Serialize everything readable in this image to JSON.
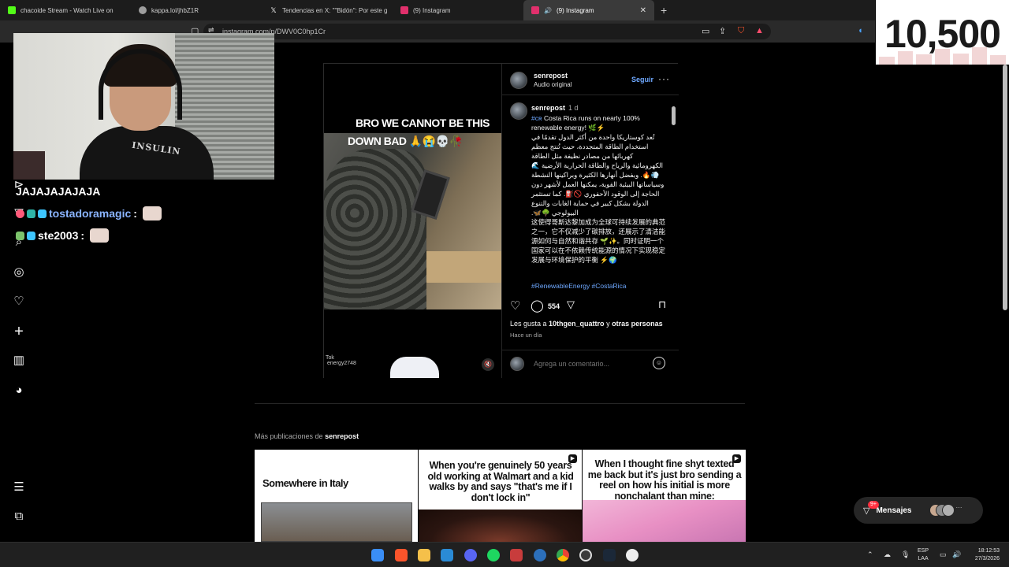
{
  "browser": {
    "tabs": [
      {
        "label": "chacoide Stream - Watch Live on",
        "color": "#53fc18"
      },
      {
        "label": "kappa.lol/jhbZ1R",
        "color": "#9e9e9e"
      },
      {
        "label": "Tendencias en X: \"\"Bidón\": Por este g",
        "color": "#ffffff"
      },
      {
        "label": "(9) Instagram",
        "color": "#e1306c"
      },
      {
        "label": "(9) Instagram",
        "color": "#e1306c"
      }
    ],
    "url": "instagram.com/p/DWV0C0hp1Cr"
  },
  "counter": {
    "value": "10,500"
  },
  "webcam": {
    "shirt_text": "INSULIN"
  },
  "chat": [
    {
      "user": "",
      "message": "JAJAJAJAJAJA"
    },
    {
      "user": "tostadoramagic",
      "message": ":"
    },
    {
      "user": "ste2003",
      "message": ":"
    }
  ],
  "post": {
    "video_caption_line1": "BRO WE CANNOT BE THIS",
    "video_caption_line2": "DOWN BAD 🙏😭💀🥀",
    "video_watermark": "Tok\n energy2748",
    "account": "senrepost",
    "audio": "Audio original",
    "follow_label": "Seguir",
    "comment_time": "1 d",
    "caption_hashtag": "#cʀ",
    "caption_en": "Costa Rica runs on nearly 100% renewable energy! 🌿⚡",
    "caption_ar": "تُعد كوستاريكا واحدة من أكثر الدول تقدمًا في استخدام الطاقة المتجددة، حيث تُنتج معظم كهربائها من مصادر نظيفة مثل الطاقة الكهرومائية والرياح والطاقة الحرارية الأرضية 🌊💨🔥. وبفضل أنهارها الكثيرة وبراكينها النشطة وسياساتها البيئية القوية، يمكنها العمل لأشهر دون الحاجة إلى الوقود الأحفوري 🚫⛽. كما تستثمر الدولة بشكل كبير في حماية الغابات والتنوع البيولوجي 🌳🦋.",
    "caption_zh": "这使得哥斯达黎加成为全球可持续发展的典范之一，它不仅减少了碳排放，还展示了清洁能源如何与自然和谐共存 🌱✨。同时证明一个国家可以在不依赖传统能源的情况下实现稳定发展与环境保护的平衡 ⚡🌍",
    "tags": "#RenewableEnergy #CostaRica",
    "comment_count": "554",
    "likes_prefix": "Les gusta a ",
    "likes_user": "10thgen_quattro",
    "likes_mid": " y ",
    "likes_others": "otras personas",
    "posted": "Hace un día",
    "add_comment_placeholder": "Agrega un comentario..."
  },
  "more_posts": {
    "label_prefix": "Más publicaciones de ",
    "account": "senrepost",
    "items": [
      {
        "text": "Somewhere in Italy"
      },
      {
        "text": "When you're genuinely 50 years old working at Walmart and a kid walks by and says \"that's me if I don't lock in\""
      },
      {
        "text": "When I thought fine shyt texted me back but it's just bro sending a reel on how his initial is more nonchalant than mine:"
      }
    ]
  },
  "messages": {
    "label": "Mensajes",
    "badge": "9+"
  },
  "taskbar": {
    "lang_line1": "ESP",
    "lang_line2": "LAA",
    "time": "18:12:53",
    "date": "27/3/2026",
    "apps": [
      "windows-start",
      "brave",
      "files",
      "bing",
      "discord",
      "spotify",
      "calendar",
      "ccleaner",
      "chrome",
      "obs",
      "steam",
      "media-player"
    ]
  }
}
